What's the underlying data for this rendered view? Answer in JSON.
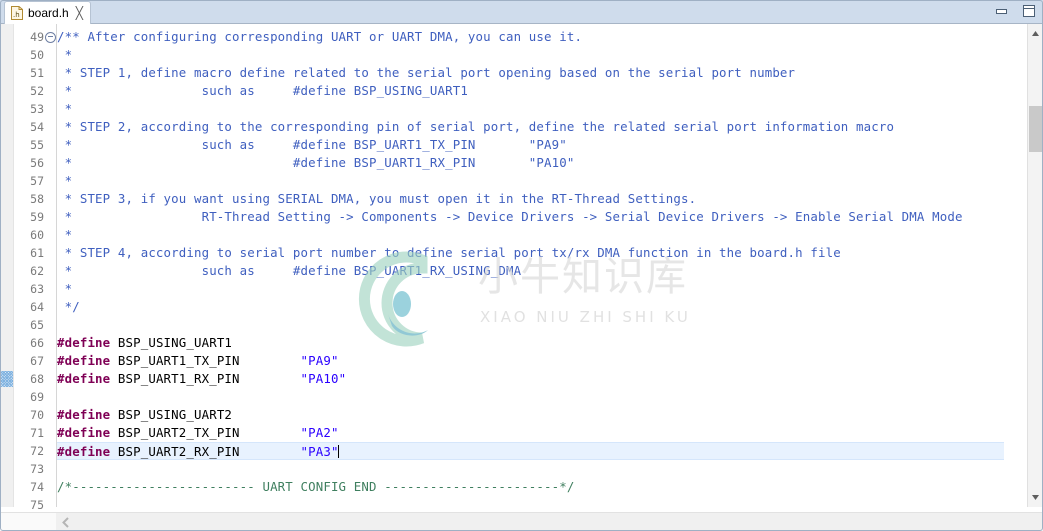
{
  "window": {
    "minimize_label": "Minimize",
    "maximize_label": "Maximize"
  },
  "tab": {
    "icon": "h-file-icon",
    "icon_text": ".h",
    "title": "board.h",
    "close_glyph": "╳"
  },
  "editor": {
    "first_visible_line": 49,
    "last_visible_line": 75,
    "current_line": 72,
    "annotation_marker_line": 68,
    "fold_marker_line": 49,
    "line_numbers": [
      49,
      50,
      51,
      52,
      53,
      54,
      55,
      56,
      57,
      58,
      59,
      60,
      61,
      62,
      63,
      64,
      65,
      66,
      67,
      68,
      69,
      70,
      71,
      72,
      73,
      74,
      75
    ],
    "lines": [
      {
        "n": 49,
        "type": "doc",
        "text": "/** After configuring corresponding UART or UART DMA, you can use it."
      },
      {
        "n": 50,
        "type": "doc",
        "text": " *"
      },
      {
        "n": 51,
        "type": "doc",
        "text": " * STEP 1, define macro define related to the serial port opening based on the serial port number"
      },
      {
        "n": 52,
        "type": "doc",
        "text": " *                 such as     #define BSP_USING_UART1"
      },
      {
        "n": 53,
        "type": "doc",
        "text": " *"
      },
      {
        "n": 54,
        "type": "doc",
        "text": " * STEP 2, according to the corresponding pin of serial port, define the related serial port information macro"
      },
      {
        "n": 55,
        "type": "doc",
        "text": " *                 such as     #define BSP_UART1_TX_PIN       \"PA9\""
      },
      {
        "n": 56,
        "type": "doc",
        "text": " *                             #define BSP_UART1_RX_PIN       \"PA10\""
      },
      {
        "n": 57,
        "type": "doc",
        "text": " *"
      },
      {
        "n": 58,
        "type": "doc",
        "text": " * STEP 3, if you want using SERIAL DMA, you must open it in the RT-Thread Settings."
      },
      {
        "n": 59,
        "type": "doc",
        "text": " *                 RT-Thread Setting -> Components -> Device Drivers -> Serial Device Drivers -> Enable Serial DMA Mode"
      },
      {
        "n": 60,
        "type": "doc",
        "text": " *"
      },
      {
        "n": 61,
        "type": "doc",
        "text": " * STEP 4, according to serial port number to define serial port tx/rx DMA function in the board.h file"
      },
      {
        "n": 62,
        "type": "doc",
        "text": " *                 such as     #define BSP_UART1_RX_USING_DMA"
      },
      {
        "n": 63,
        "type": "doc",
        "text": " *"
      },
      {
        "n": 64,
        "type": "doc",
        "text": " */"
      },
      {
        "n": 65,
        "type": "blank",
        "text": ""
      },
      {
        "n": 66,
        "type": "define",
        "keyword": "#define",
        "name": " BSP_USING_UART1",
        "value": ""
      },
      {
        "n": 67,
        "type": "define",
        "keyword": "#define",
        "name": " BSP_UART1_TX_PIN",
        "pad": "        ",
        "value": "\"PA9\""
      },
      {
        "n": 68,
        "type": "define",
        "keyword": "#define",
        "name": " BSP_UART1_RX_PIN",
        "pad": "        ",
        "value": "\"PA10\""
      },
      {
        "n": 69,
        "type": "blank",
        "text": ""
      },
      {
        "n": 70,
        "type": "define",
        "keyword": "#define",
        "name": " BSP_USING_UART2",
        "value": ""
      },
      {
        "n": 71,
        "type": "define",
        "keyword": "#define",
        "name": " BSP_UART2_TX_PIN",
        "pad": "        ",
        "value": "\"PA2\""
      },
      {
        "n": 72,
        "type": "define",
        "keyword": "#define",
        "name": " BSP_UART2_RX_PIN",
        "pad": "        ",
        "value": "\"PA3\""
      },
      {
        "n": 73,
        "type": "blank",
        "text": ""
      },
      {
        "n": 74,
        "type": "comment",
        "text": "/*------------------------ UART CONFIG END -----------------------*/"
      },
      {
        "n": 75,
        "type": "blank",
        "text": ""
      }
    ]
  },
  "watermark": {
    "cn_text": "小牛知识库",
    "py_text": "XIAO NIU ZHI SHI KU"
  },
  "colors": {
    "doc_comment": "#3f5fbf",
    "block_comment": "#3f7f5f",
    "preprocessor": "#7f0055",
    "string": "#2a00ff",
    "line_number": "#7a7a7a",
    "current_line_bg": "#e8f2fe",
    "tabbar_bg": "#cfdcec",
    "watermark_logo": "#79c6b2"
  },
  "scrollbars": {
    "vertical_up": "scroll-up",
    "vertical_down": "scroll-down",
    "horizontal_left": "scroll-left"
  }
}
